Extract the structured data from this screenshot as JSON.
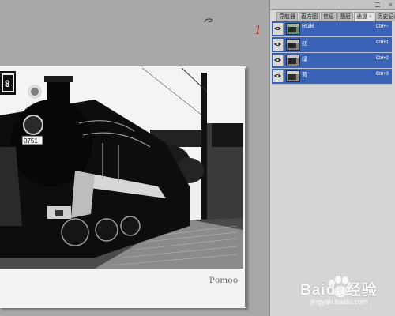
{
  "document": {
    "signature": "Pomoo",
    "photo_badge": "8",
    "locomotive_number": "0751"
  },
  "panel": {
    "tabs": [
      {
        "label": "导航器",
        "active": false
      },
      {
        "label": "直方图",
        "active": false
      },
      {
        "label": "信息",
        "active": false
      },
      {
        "label": "图层",
        "active": false
      },
      {
        "label": "通道",
        "active": true,
        "close": "×"
      },
      {
        "label": "历史记录",
        "active": false
      }
    ],
    "close_label": "×",
    "channels": [
      {
        "name": "RGB",
        "shortcut": "Ctrl+~",
        "thumb": "color-thumb"
      },
      {
        "name": "红",
        "shortcut": "Ctrl+1",
        "thumb": "red-thumb"
      },
      {
        "name": "绿",
        "shortcut": "Ctrl+2",
        "thumb": "green-thumb"
      },
      {
        "name": "蓝",
        "shortcut": "Ctrl+3",
        "thumb": "blue-thumb"
      }
    ],
    "selection_color": "#3a63b8"
  },
  "annotation": {
    "number": "1",
    "color": "#c02222"
  },
  "watermark": {
    "brand": "Baidu经验",
    "url": "jingyan.baidu.com"
  }
}
